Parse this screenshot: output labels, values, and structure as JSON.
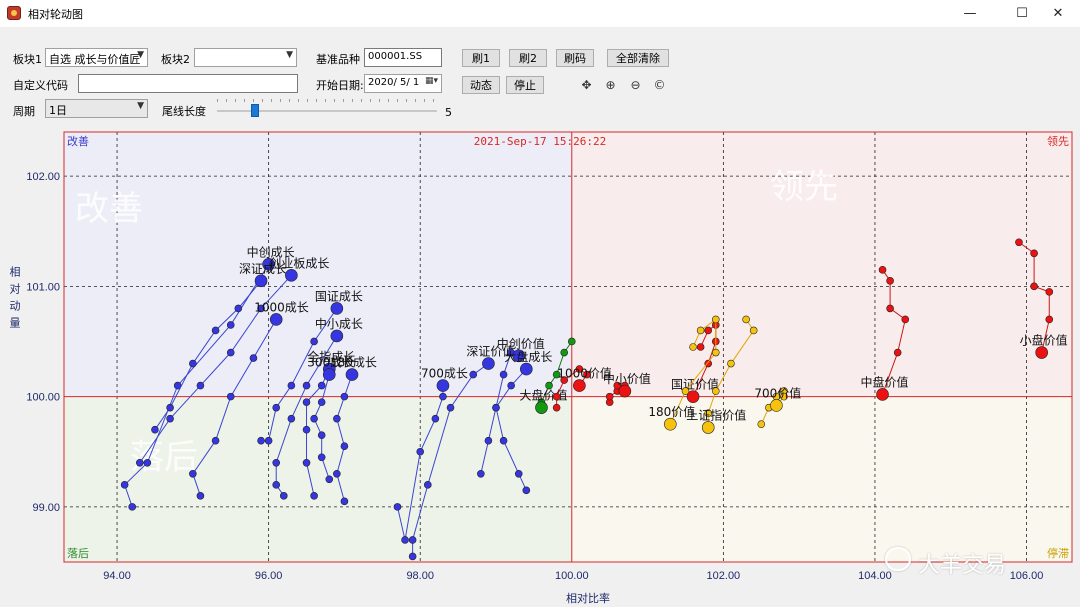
{
  "window": {
    "title": "相对轮动图",
    "minimize": "—",
    "maximize": "☐",
    "close": "✕"
  },
  "controls": {
    "block1_label": "板块1",
    "block1_value": "自选 成长与价值匠",
    "block2_label": "板块2",
    "block2_value": "",
    "benchmark_label": "基准品种",
    "benchmark_value": "000001.SS",
    "custom_code_label": "自定义代码",
    "custom_code_value": "",
    "start_date_label": "开始日期:",
    "start_date_value": "2020/ 5/ 1",
    "period_label": "周期",
    "period_value": "1日",
    "tail_label": "尾线长度",
    "tail_value": "5",
    "btn_refresh1": "刷1",
    "btn_refresh2": "刷2",
    "btn_refresh_code": "刷码",
    "btn_clear_all": "全部清除",
    "btn_animate": "动态",
    "btn_stop": "停止"
  },
  "tools": [
    "move-icon",
    "zoom-in-icon",
    "zoom-out-icon",
    "reset-icon"
  ],
  "chart_data": {
    "type": "scatter",
    "timestamp": "2021-Sep-17 15:26:22",
    "xlabel": "相对比率",
    "ylabel": "相对动量",
    "xlim": [
      93.3,
      106.6
    ],
    "ylim": [
      98.5,
      102.4
    ],
    "xticks": [
      "94.00",
      "96.00",
      "98.00",
      "100.00",
      "102.00",
      "104.00",
      "106.00"
    ],
    "yticks": [
      "99.00",
      "100.00",
      "101.00",
      "102.00"
    ],
    "quadrants": {
      "top_left": "改善",
      "top_right": "领先",
      "bottom_left": "落后",
      "bottom_right": "停滞"
    },
    "colors": {
      "blue": "#3333dd",
      "green": "#119911",
      "red": "#e41818",
      "yellow": "#f3bf0c"
    },
    "series": [
      {
        "name": "中创成长",
        "color": "blue",
        "points": [
          [
            94.2,
            99.0
          ],
          [
            94.1,
            99.2
          ],
          [
            94.4,
            99.4
          ],
          [
            94.8,
            100.1
          ],
          [
            95.5,
            100.65
          ],
          [
            96.0,
            101.2
          ]
        ]
      },
      {
        "name": "深证成长",
        "color": "blue",
        "points": [
          [
            94.5,
            99.7
          ],
          [
            94.7,
            99.9
          ],
          [
            95.0,
            100.3
          ],
          [
            95.3,
            100.6
          ],
          [
            95.6,
            100.8
          ],
          [
            95.9,
            101.05
          ]
        ]
      },
      {
        "name": "创业板成长",
        "color": "blue",
        "points": [
          [
            94.3,
            99.4
          ],
          [
            94.7,
            99.8
          ],
          [
            95.1,
            100.1
          ],
          [
            95.5,
            100.4
          ],
          [
            95.9,
            100.8
          ],
          [
            96.3,
            101.1
          ]
        ]
      },
      {
        "name": "1000成长",
        "color": "blue",
        "points": [
          [
            95.1,
            99.1
          ],
          [
            95.0,
            99.3
          ],
          [
            95.3,
            99.6
          ],
          [
            95.5,
            100.0
          ],
          [
            95.8,
            100.35
          ],
          [
            96.1,
            100.7
          ]
        ]
      },
      {
        "name": "国证成长",
        "color": "blue",
        "points": [
          [
            95.9,
            99.6
          ],
          [
            96.0,
            99.6
          ],
          [
            96.1,
            99.9
          ],
          [
            96.3,
            100.1
          ],
          [
            96.6,
            100.5
          ],
          [
            96.9,
            100.8
          ]
        ]
      },
      {
        "name": "中小成长",
        "color": "blue",
        "points": [
          [
            96.2,
            99.1
          ],
          [
            96.1,
            99.2
          ],
          [
            96.1,
            99.4
          ],
          [
            96.3,
            99.8
          ],
          [
            96.5,
            100.1
          ],
          [
            96.9,
            100.55
          ]
        ]
      },
      {
        "name": "全指成长",
        "color": "blue",
        "points": [
          [
            96.6,
            99.1
          ],
          [
            96.5,
            99.4
          ],
          [
            96.5,
            99.7
          ],
          [
            96.5,
            99.95
          ],
          [
            96.7,
            100.1
          ],
          [
            96.8,
            100.25
          ]
        ]
      },
      {
        "name": "300成长",
        "color": "blue",
        "points": [
          [
            96.8,
            99.25
          ],
          [
            96.7,
            99.45
          ],
          [
            96.7,
            99.65
          ],
          [
            96.6,
            99.8
          ],
          [
            96.7,
            99.95
          ],
          [
            96.8,
            100.2
          ]
        ]
      },
      {
        "name": "180成长",
        "color": "blue",
        "points": [
          [
            97.0,
            99.05
          ],
          [
            96.9,
            99.3
          ],
          [
            97.0,
            99.55
          ],
          [
            96.9,
            99.8
          ],
          [
            97.0,
            100.0
          ],
          [
            97.1,
            100.2
          ]
        ]
      },
      {
        "name": "700成长",
        "color": "blue",
        "points": [
          [
            97.7,
            99.0
          ],
          [
            97.8,
            98.7
          ],
          [
            98.0,
            99.5
          ],
          [
            98.2,
            99.8
          ],
          [
            98.3,
            100.0
          ],
          [
            98.3,
            100.1
          ]
        ]
      },
      {
        "name": "深证价值",
        "color": "blue",
        "points": [
          [
            97.9,
            98.55
          ],
          [
            97.9,
            98.7
          ],
          [
            98.1,
            99.2
          ],
          [
            98.4,
            99.9
          ],
          [
            98.7,
            100.2
          ],
          [
            98.9,
            100.3
          ]
        ]
      },
      {
        "name": "中创价值",
        "color": "blue",
        "points": [
          [
            98.8,
            99.3
          ],
          [
            98.9,
            99.6
          ],
          [
            99.0,
            99.9
          ],
          [
            99.1,
            100.2
          ],
          [
            99.2,
            100.4
          ],
          [
            99.3,
            100.37
          ]
        ]
      },
      {
        "name": "大盘成长",
        "color": "blue",
        "points": [
          [
            99.4,
            99.15
          ],
          [
            99.3,
            99.3
          ],
          [
            99.1,
            99.6
          ],
          [
            99.0,
            99.9
          ],
          [
            99.2,
            100.1
          ],
          [
            99.4,
            100.25
          ]
        ]
      },
      {
        "name": "大盘价值",
        "color": "green",
        "points": [
          [
            100.0,
            100.5
          ],
          [
            99.9,
            100.4
          ],
          [
            99.8,
            100.2
          ],
          [
            99.7,
            100.1
          ],
          [
            99.6,
            99.95
          ],
          [
            99.6,
            99.9
          ]
        ]
      },
      {
        "name": "1000价值",
        "color": "red",
        "points": [
          [
            99.8,
            99.9
          ],
          [
            99.8,
            100.0
          ],
          [
            99.9,
            100.15
          ],
          [
            100.1,
            100.25
          ],
          [
            100.2,
            100.2
          ],
          [
            100.1,
            100.1
          ]
        ]
      },
      {
        "name": "中小价值",
        "color": "red",
        "points": [
          [
            100.5,
            99.95
          ],
          [
            100.5,
            100.0
          ],
          [
            100.6,
            100.05
          ],
          [
            100.6,
            100.1
          ],
          [
            100.7,
            100.1
          ],
          [
            100.7,
            100.05
          ]
        ]
      },
      {
        "name": "国证价值",
        "color": "red",
        "points": [
          [
            101.7,
            100.45
          ],
          [
            101.8,
            100.6
          ],
          [
            101.9,
            100.65
          ],
          [
            101.9,
            100.5
          ],
          [
            101.8,
            100.3
          ],
          [
            101.6,
            100.0
          ]
        ]
      },
      {
        "name": "180价值",
        "color": "yellow",
        "points": [
          [
            101.6,
            100.45
          ],
          [
            101.7,
            100.6
          ],
          [
            101.9,
            100.7
          ],
          [
            101.9,
            100.4
          ],
          [
            101.5,
            100.05
          ],
          [
            101.3,
            99.75
          ]
        ]
      },
      {
        "name": "上证指价值",
        "color": "yellow",
        "points": [
          [
            102.3,
            100.7
          ],
          [
            102.4,
            100.6
          ],
          [
            102.1,
            100.3
          ],
          [
            101.9,
            100.05
          ],
          [
            101.8,
            99.85
          ],
          [
            101.8,
            99.72
          ]
        ]
      },
      {
        "name": "700价值",
        "color": "yellow",
        "points": [
          [
            102.5,
            99.75
          ],
          [
            102.6,
            99.9
          ],
          [
            102.7,
            100.0
          ],
          [
            102.8,
            100.05
          ],
          [
            102.8,
            100.0
          ],
          [
            102.7,
            99.92
          ]
        ]
      },
      {
        "name": "中盘价值",
        "color": "red",
        "points": [
          [
            104.1,
            101.15
          ],
          [
            104.2,
            101.05
          ],
          [
            104.2,
            100.8
          ],
          [
            104.4,
            100.7
          ],
          [
            104.3,
            100.4
          ],
          [
            104.1,
            100.02
          ]
        ]
      },
      {
        "name": "小盘价值",
        "color": "red",
        "points": [
          [
            105.9,
            101.4
          ],
          [
            106.1,
            101.3
          ],
          [
            106.1,
            101.0
          ],
          [
            106.3,
            100.95
          ],
          [
            106.3,
            100.7
          ],
          [
            106.2,
            100.4
          ]
        ]
      }
    ],
    "bg_text_left_top": "改善",
    "bg_text_right_top": "领先",
    "bg_text_left_bottom": "落后"
  },
  "watermark": "大羊交易"
}
